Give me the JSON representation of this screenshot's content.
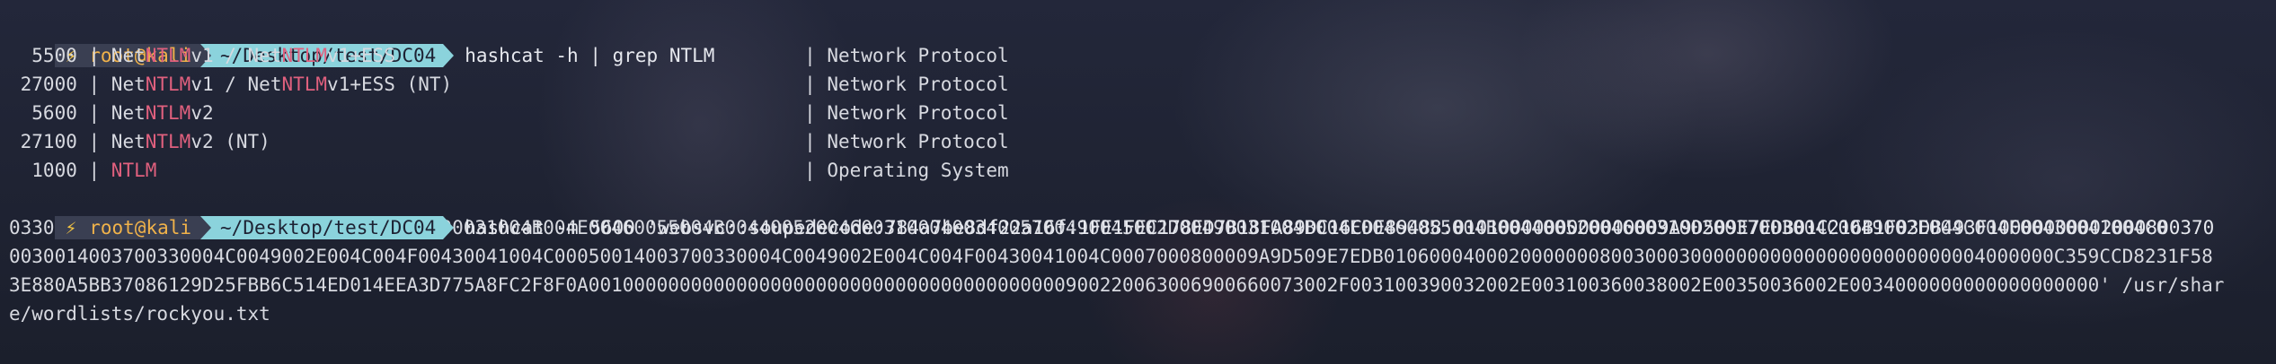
{
  "prompt": {
    "icon": "lightning-icon",
    "icon_glyph": "⚡",
    "user_host": "root@kali",
    "path": "~/Desktop/test/DC04"
  },
  "command1": "hashcat -h | grep NTLM",
  "results": [
    {
      "mode": "  5500",
      "p1": "Net",
      "h1": "NTLM",
      "p2": "v1 / Net",
      "h2": "NTLM",
      "p3": "v1+ESS",
      "category": "Network Protocol"
    },
    {
      "mode": " 27000",
      "p1": "Net",
      "h1": "NTLM",
      "p2": "v1 / Net",
      "h2": "NTLM",
      "p3": "v1+ESS (NT)",
      "category": "Network Protocol"
    },
    {
      "mode": "  5600",
      "p1": "Net",
      "h1": "NTLM",
      "p2": "v2",
      "h2": "",
      "p3": "",
      "category": "Network Protocol"
    },
    {
      "mode": " 27100",
      "p1": "Net",
      "h1": "NTLM",
      "p2": "v2 (NT)",
      "h2": "",
      "p3": "",
      "category": "Network Protocol"
    },
    {
      "mode": "  1000",
      "p1": "",
      "h1": "NTLM",
      "p2": "",
      "h2": "",
      "p3": "",
      "category": "Operating System"
    }
  ],
  "command2": {
    "first": "hashcat -m 5600 'websvc::soupedecode:784a7be8df22a16f:1FE1FEC178ED7B18FA89DC16CDE89488:0101000000000000009A9D509E7EDB01C216B1F03DB493F10000000002000800370",
    "wrapped": [
      "033004C00490001001E00570049004E002D00490031004B004E00460055004B004400520046003100040034005700490045002D00490031004B004E00460055004B00440052004600310020037003004C0049002E004C004F00430041004C0",
      "0030014003700330004C0049002E004C004F00430041004C00050014003700330004C0049002E004C004F00430041004C0007000800009A9D509E7EDB01060004000200000008003000300000000000000000000000004000000C359CCD8231F58",
      "3E880A5BB37086129D25FBB6C514ED014EEA3D775A8FC2F8F0A001000000000000000000000000000000000000000900220063006900660073002F003100390032002E003100360038002E00350036002E0034000000000000000000' /usr/shar",
      "e/wordlists/rockyou.txt"
    ]
  }
}
